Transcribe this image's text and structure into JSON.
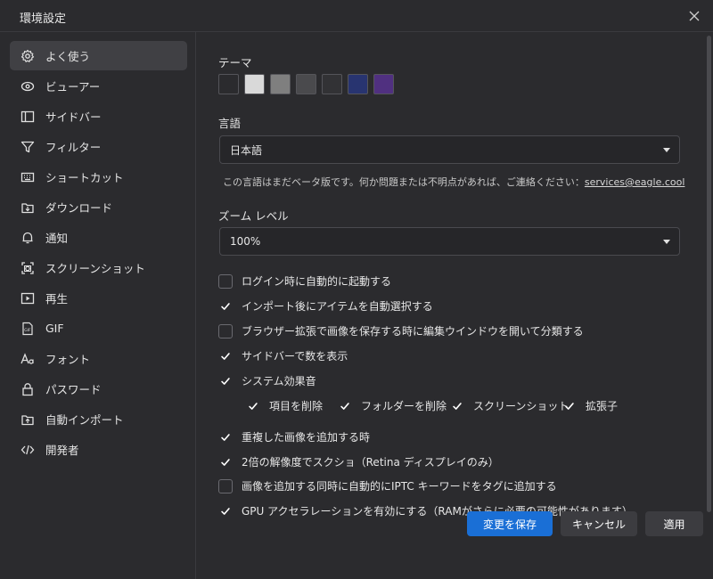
{
  "window": {
    "title": "環境設定"
  },
  "sidebar": {
    "items": [
      {
        "label": "よく使う",
        "icon": "gear-icon",
        "active": true
      },
      {
        "label": "ビューアー",
        "icon": "eye-icon"
      },
      {
        "label": "サイドバー",
        "icon": "sidebar-icon"
      },
      {
        "label": "フィルター",
        "icon": "filter-icon"
      },
      {
        "label": "ショートカット",
        "icon": "keyboard-icon"
      },
      {
        "label": "ダウンロード",
        "icon": "download-icon"
      },
      {
        "label": "通知",
        "icon": "bell-icon"
      },
      {
        "label": "スクリーンショット",
        "icon": "screenshot-icon"
      },
      {
        "label": "再生",
        "icon": "play-icon"
      },
      {
        "label": "GIF",
        "icon": "gif-icon"
      },
      {
        "label": "フォント",
        "icon": "font-icon"
      },
      {
        "label": "パスワード",
        "icon": "lock-icon"
      },
      {
        "label": "自動インポート",
        "icon": "import-icon"
      },
      {
        "label": "開発者",
        "icon": "code-icon"
      }
    ]
  },
  "theme": {
    "label": "テーマ",
    "swatches": [
      "#2b2b2e",
      "#d9d9d9",
      "#7f7f7f",
      "#4a4a4d",
      "#323235",
      "#283470",
      "#503080"
    ]
  },
  "language": {
    "label": "言語",
    "value": "日本語",
    "note": "この言語はまだベータ版です。何か問題または不明点があれば、ご連絡ください：",
    "email": "services@eagle.cool"
  },
  "zoom": {
    "label": "ズーム レベル",
    "value": "100%"
  },
  "options": [
    {
      "label": "ログイン時に自動的に起動する",
      "checked": false
    },
    {
      "label": "インポート後にアイテムを自動選択する",
      "checked": true
    },
    {
      "label": "ブラウザー拡張で画像を保存する時に編集ウインドウを開いて分類する",
      "checked": false
    },
    {
      "label": "サイドバーで数を表示",
      "checked": true
    },
    {
      "label": "システム効果音",
      "checked": true
    }
  ],
  "sound_sub": [
    {
      "label": "項目を削除",
      "checked": true
    },
    {
      "label": "フォルダーを削除",
      "checked": true
    },
    {
      "label": "スクリーンショット",
      "checked": true
    },
    {
      "label": "拡張子",
      "checked": true
    }
  ],
  "options2": [
    {
      "label": "重複した画像を追加する時",
      "checked": true
    },
    {
      "label": "2倍の解像度でスクショ（Retina ディスプレイのみ）",
      "checked": true
    },
    {
      "label": "画像を追加する同時に自動的にIPTC キーワードをタグに追加する",
      "checked": false
    },
    {
      "label": "GPU アクセラレーションを有効にする（RAMがさらに必要の可能性があります）",
      "checked": true
    }
  ],
  "buttons": {
    "save": "変更を保存",
    "cancel": "キャンセル",
    "apply": "適用"
  },
  "colors": {
    "accent": "#1a6fd6",
    "bg": "#2b2b2e",
    "active": "#404044"
  }
}
